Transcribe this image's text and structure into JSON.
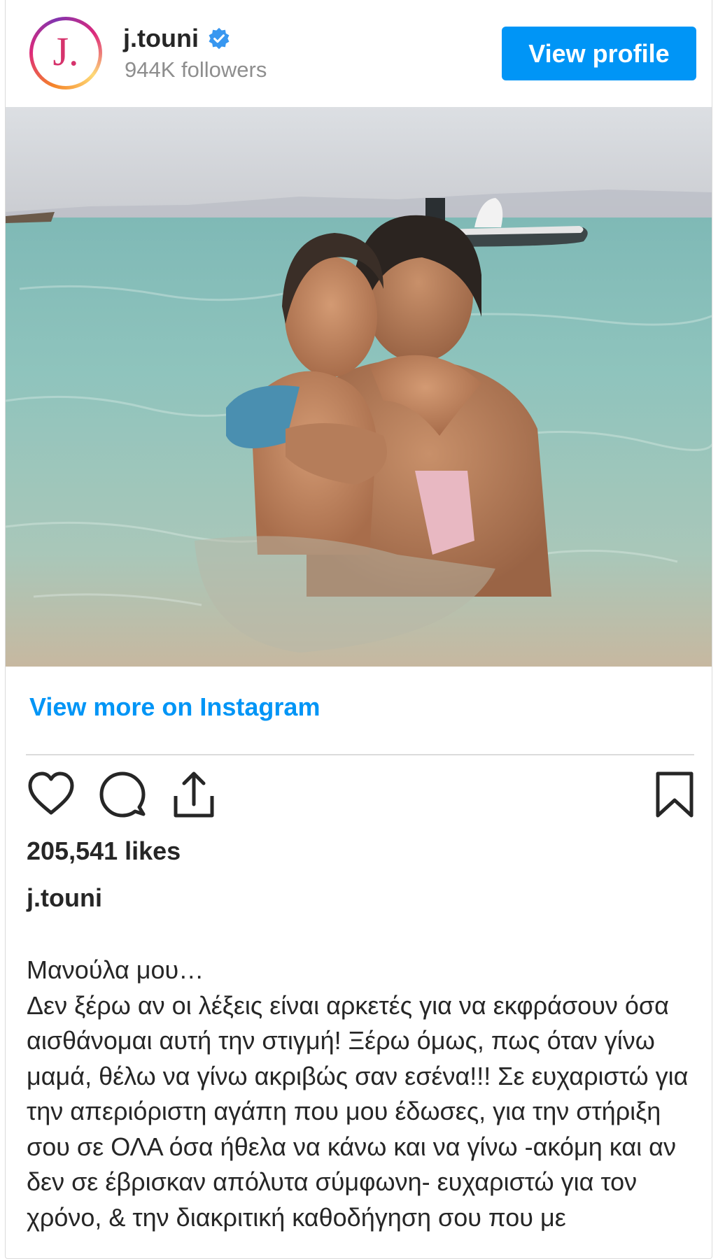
{
  "profile": {
    "avatar_letter": "J.",
    "username": "j.touni",
    "verified": true,
    "followers": "944K followers",
    "view_profile_label": "View profile"
  },
  "post": {
    "image_alt": "Girl hugging her mother in the sea, boat in background",
    "view_more_label": "View more on Instagram",
    "likes": "205,541 likes",
    "caption_username": "j.touni",
    "caption_text": "Μανούλα μου…\nΔεν ξέρω αν οι λέξεις είναι αρκετές για να εκφράσουν όσα αισθάνομαι αυτή την στιγμή! Ξέρω όμως, πως όταν γίνω μαμά, θέλω να γίνω ακριβώς σαν εσένα!!! Σε ευχαριστώ για την απεριόριστη αγάπη που μου έδωσες, για την στήριξη σου σε ΟΛΑ όσα ήθελα να κάνω και να γίνω -ακόμη και αν δεν σε έβρισκαν απόλυτα σύμφωνη- ευχαριστώ για τον χρόνο, & την διακριτική καθοδήγηση σου που με"
  },
  "icons": {
    "like": "heart-icon",
    "comment": "comment-icon",
    "share": "share-icon",
    "save": "bookmark-icon",
    "verified": "verified-badge-icon"
  },
  "colors": {
    "accent": "#0095f6",
    "text": "#262626",
    "muted": "#8e8e8e"
  }
}
